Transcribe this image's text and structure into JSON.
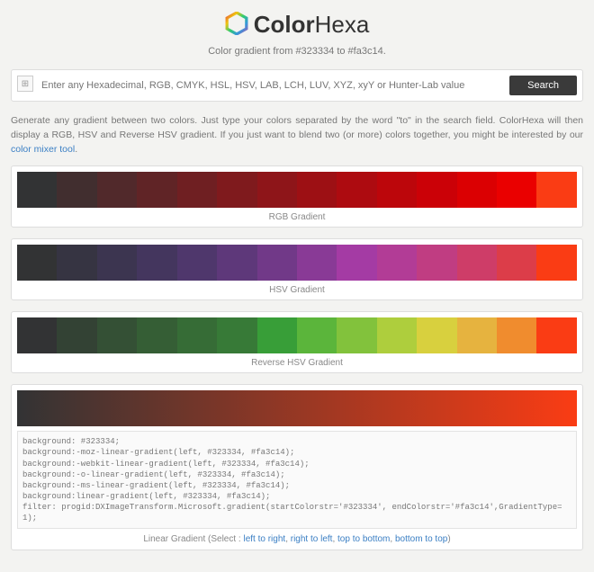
{
  "header": {
    "title_prefix": "Color",
    "title_suffix": "Hexa",
    "subtitle": "Color gradient from #323334 to #fa3c14."
  },
  "search": {
    "placeholder": "Enter any Hexadecimal, RGB, CMYK, HSL, HSV, LAB, LCH, LUV, XYZ, xyY or Hunter-Lab value",
    "button": "Search"
  },
  "intro": {
    "text_before": "Generate any gradient between two colors. Just type your colors separated by the word \"to\" in the search field. ColorHexa will then display a RGB, HSV and Reverse HSV gradient. If you just want to blend two (or more) colors together, you might be interested by our ",
    "link_text": "color mixer tool",
    "text_after": "."
  },
  "labels": {
    "rgb": "RGB Gradient",
    "hsv": "HSV Gradient",
    "rhsv": "Reverse HSV Gradient",
    "linear_prefix": "Linear Gradient (Select : ",
    "linear_suffix": ")"
  },
  "chart_data": {
    "type": "table",
    "title": "Color gradient swatches #323334 → #fa3c14",
    "rgb": [
      "#323334",
      "#412e2f",
      "#51292b",
      "#602426",
      "#6f1f22",
      "#7f1a1d",
      "#8e1519",
      "#9d1014",
      "#ad0b10",
      "#bc060b",
      "#cb0107",
      "#db0002",
      "#ea0000",
      "#fa3c14"
    ],
    "hsv": [
      "#323334",
      "#363442",
      "#3c3550",
      "#44365e",
      "#4f376c",
      "#5e387a",
      "#713988",
      "#893a96",
      "#a43ba4",
      "#b23c96",
      "#c03d82",
      "#ce3d68",
      "#dc3d49",
      "#fa3c14"
    ],
    "rhsv": [
      "#323334",
      "#334234",
      "#345035",
      "#355e35",
      "#366c36",
      "#377a37",
      "#389e38",
      "#5bb53b",
      "#82c23c",
      "#aece3d",
      "#d8d03e",
      "#e6b33f",
      "#f08c2e",
      "#fa3c14"
    ]
  },
  "linear": {
    "start": "#323334",
    "end": "#fa3c14",
    "code": "background: #323334;\nbackground:-moz-linear-gradient(left, #323334, #fa3c14);\nbackground:-webkit-linear-gradient(left, #323334, #fa3c14);\nbackground:-o-linear-gradient(left, #323334, #fa3c14);\nbackground:-ms-linear-gradient(left, #323334, #fa3c14);\nbackground:linear-gradient(left, #323334, #fa3c14);\nfilter: progid:DXImageTransform.Microsoft.gradient(startColorstr='#323334', endColorstr='#fa3c14',GradientType=1);"
  },
  "directions": [
    "left to right",
    "right to left",
    "top to bottom",
    "bottom to top"
  ]
}
